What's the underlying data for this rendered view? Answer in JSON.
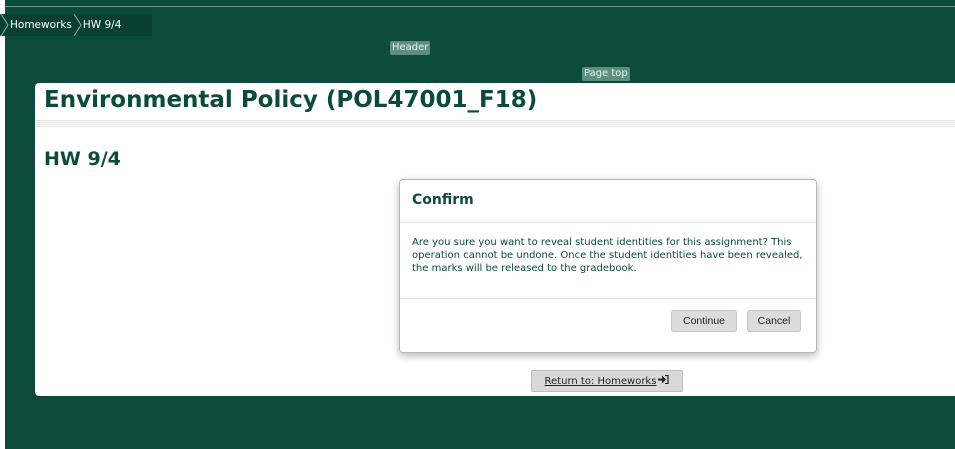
{
  "breadcrumb": {
    "items": [
      "Homeworks",
      "HW 9/4"
    ]
  },
  "skip_links": {
    "header": "Header",
    "page_top": "Page top"
  },
  "course": {
    "title": "Environmental Policy (POL47001_F18)"
  },
  "assignment": {
    "title": "HW 9/4"
  },
  "dialog": {
    "title": "Confirm",
    "message": "Are you sure you want to reveal student identities for this assignment? This operation cannot be undone. Once the student identities have been revealed, the marks will be released to the gradebook.",
    "continue_label": "Continue",
    "cancel_label": "Cancel"
  },
  "return_button": {
    "label": "Return to: Homeworks",
    "icon": "sign-in-icon"
  },
  "colors": {
    "brand_dark_green": "#0c4a3b",
    "skip_link_bg": "#5c8f80",
    "button_gray": "#dcdcdc"
  }
}
